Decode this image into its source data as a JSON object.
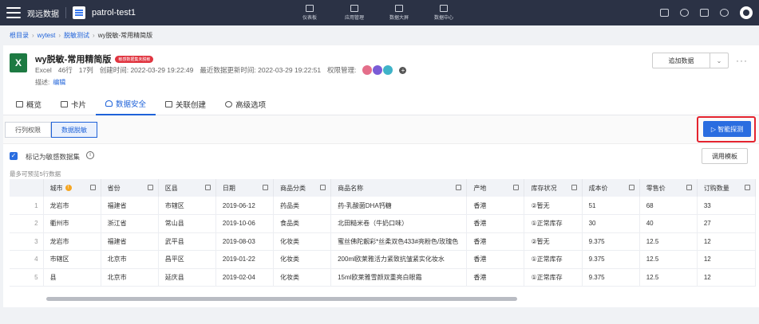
{
  "topbar": {
    "brand": "观远数据",
    "dataset_name": "patrol-test1",
    "nav": [
      {
        "label": "仪表板",
        "icon": "chart-bar-icon"
      },
      {
        "label": "应用管理",
        "icon": "apps-icon"
      },
      {
        "label": "数据大屏",
        "icon": "screen-icon"
      },
      {
        "label": "数据中心",
        "icon": "database-icon"
      }
    ]
  },
  "breadcrumb": {
    "items": [
      "根目录",
      "wytest",
      "脱敏测试"
    ],
    "current": "wy脱敏-常用精简版"
  },
  "dataset": {
    "title": "wy脱敏-常用精简版",
    "badge": "敏感数据集未脱敏",
    "type": "Excel",
    "rows": "46行",
    "cols": "17列",
    "created": "创建时间: 2022-03-29 19:22:49",
    "updated": "最近数据更新时间: 2022-03-29 19:22:51",
    "perm_label": "权限管理:",
    "desc_label": "描述:",
    "desc_edit": "编辑",
    "add_data": "追加数据"
  },
  "tabs": [
    {
      "label": "概览",
      "icon": "overview-icon"
    },
    {
      "label": "卡片",
      "icon": "card-icon"
    },
    {
      "label": "数据安全",
      "icon": "shield-icon",
      "active": true
    },
    {
      "label": "关联创建",
      "icon": "link-icon"
    },
    {
      "label": "高级选项",
      "icon": "gear-icon"
    }
  ],
  "subtabs": {
    "row_col": "行列权限",
    "mask": "数据脱敏",
    "smart_detect": "▷ 智能探测"
  },
  "options": {
    "mark_sensitive": "标记为敏感数据集",
    "template": "调用模板",
    "preview_note": "最多可预览5行数据"
  },
  "table": {
    "headers": [
      "城市",
      "省份",
      "区县",
      "日期",
      "商品分类",
      "商品名称",
      "产地",
      "库存状况",
      "成本价",
      "零售价",
      "订购数量"
    ],
    "rows": [
      [
        "1",
        "龙岩市",
        "福建省",
        "市辖区",
        "2019-06-12",
        "药品类",
        "药-乳酸菌DHA钙糖",
        "香港",
        "②暂无",
        "51",
        "68",
        "33"
      ],
      [
        "2",
        "衢州市",
        "浙江省",
        "常山县",
        "2019-10-06",
        "食品类",
        "北田糙米卷（牛奶口味）",
        "香港",
        "①正常库存",
        "30",
        "40",
        "27"
      ],
      [
        "3",
        "龙岩市",
        "福建省",
        "武平县",
        "2019-08-03",
        "化妆类",
        "蜜丝佛陀靓彩*丝柔双色433#亮粉色/玫瑰色",
        "香港",
        "②暂无",
        "9.375",
        "12.5",
        "12"
      ],
      [
        "4",
        "市辖区",
        "北京市",
        "昌平区",
        "2019-01-22",
        "化妆类",
        "200ml欧莱雅活力紧致抗皱紧实化妆水",
        "香港",
        "①正常库存",
        "9.375",
        "12.5",
        "12"
      ],
      [
        "5",
        "县",
        "北京市",
        "延庆县",
        "2019-02-04",
        "化妆类",
        "15ml欧莱雅雪颜双重亮白眼霜",
        "香港",
        "①正常库存",
        "9.375",
        "12.5",
        "12"
      ]
    ]
  }
}
